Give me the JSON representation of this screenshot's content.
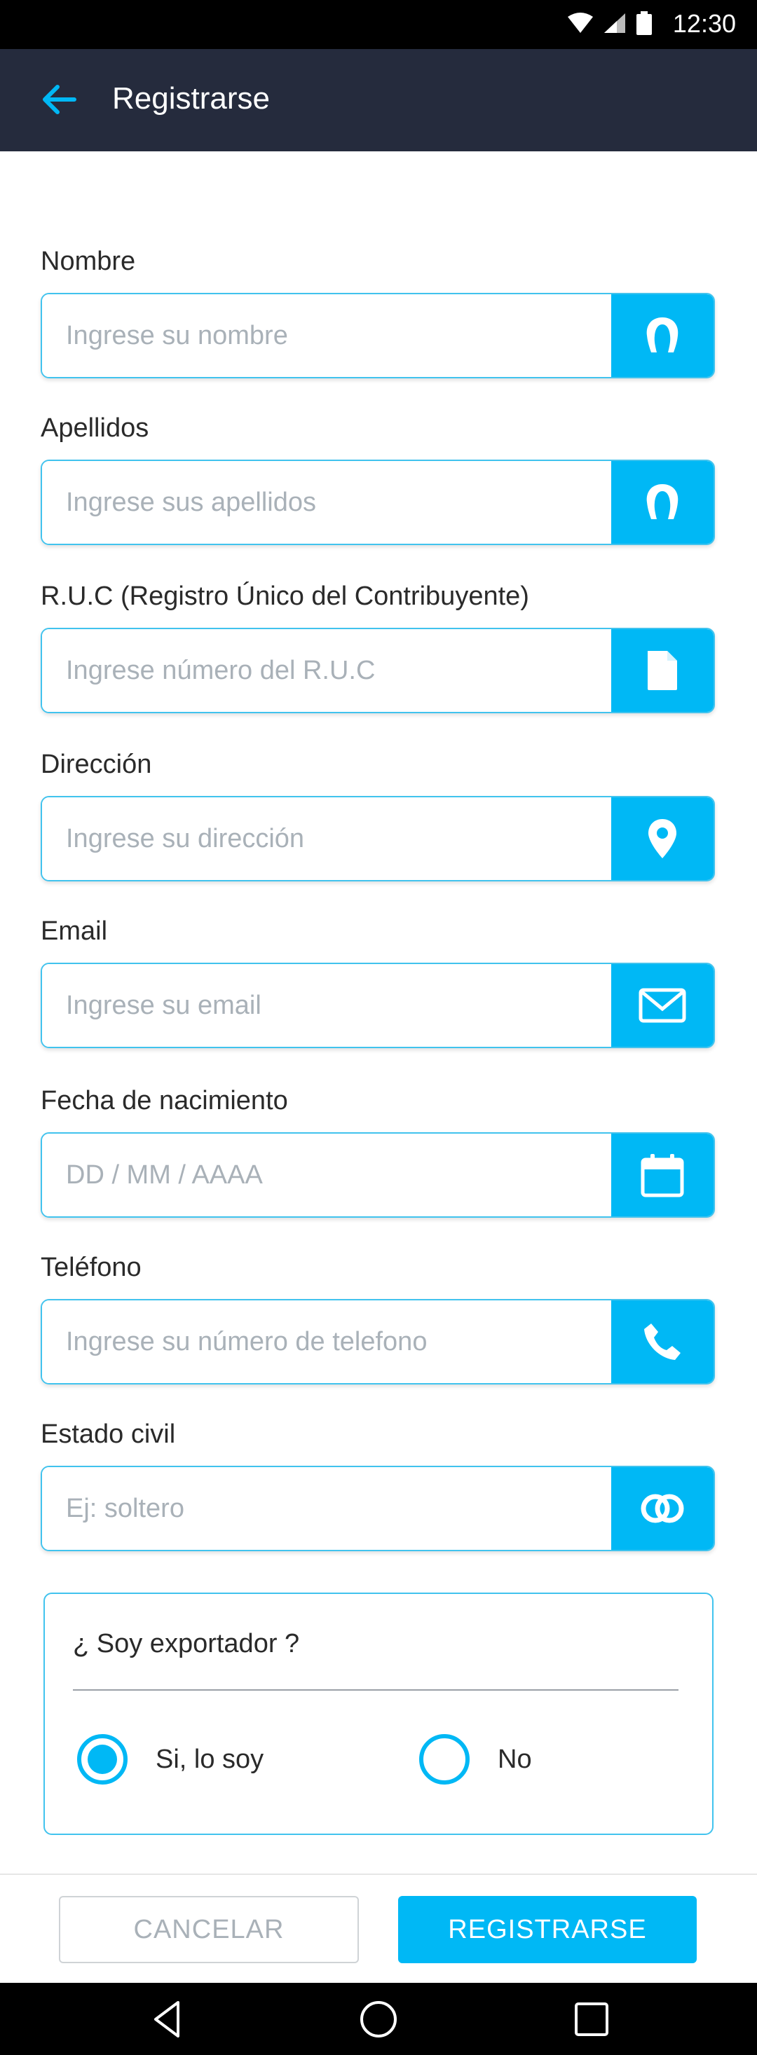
{
  "status_bar": {
    "time": "12:30"
  },
  "app_bar": {
    "title": "Registrarse"
  },
  "form": {
    "fields": [
      {
        "label": "Nombre",
        "placeholder": "Ingrese su nombre",
        "icon": "user-icon"
      },
      {
        "label": "Apellidos",
        "placeholder": "Ingrese sus apellidos",
        "icon": "user-icon"
      },
      {
        "label": "R.U.C (Registro Único del Contribuyente)",
        "placeholder": "Ingrese número del R.U.C",
        "icon": "document-icon"
      },
      {
        "label": "Dirección",
        "placeholder": "Ingrese su dirección",
        "icon": "location-pin-icon"
      },
      {
        "label": "Email",
        "placeholder": "Ingrese su email",
        "icon": "mail-icon"
      },
      {
        "label": "Fecha de nacimiento",
        "placeholder": "DD / MM / AAAA",
        "icon": "calendar-icon"
      },
      {
        "label": "Teléfono",
        "placeholder": "Ingrese su número de telefono",
        "icon": "phone-icon"
      },
      {
        "label": "Estado civil",
        "placeholder": "Ej: soltero",
        "icon": "rings-icon"
      }
    ],
    "exporter": {
      "question": "¿ Soy exportador ?",
      "options": [
        {
          "label": "Si, lo soy",
          "selected": true
        },
        {
          "label": "No",
          "selected": false
        }
      ]
    }
  },
  "actions": {
    "cancel_label": "CANCELAR",
    "submit_label": "REGISTRARSE"
  },
  "colors": {
    "accent": "#00b8f5",
    "appbar": "#252b3d",
    "border": "#41c3ee"
  }
}
